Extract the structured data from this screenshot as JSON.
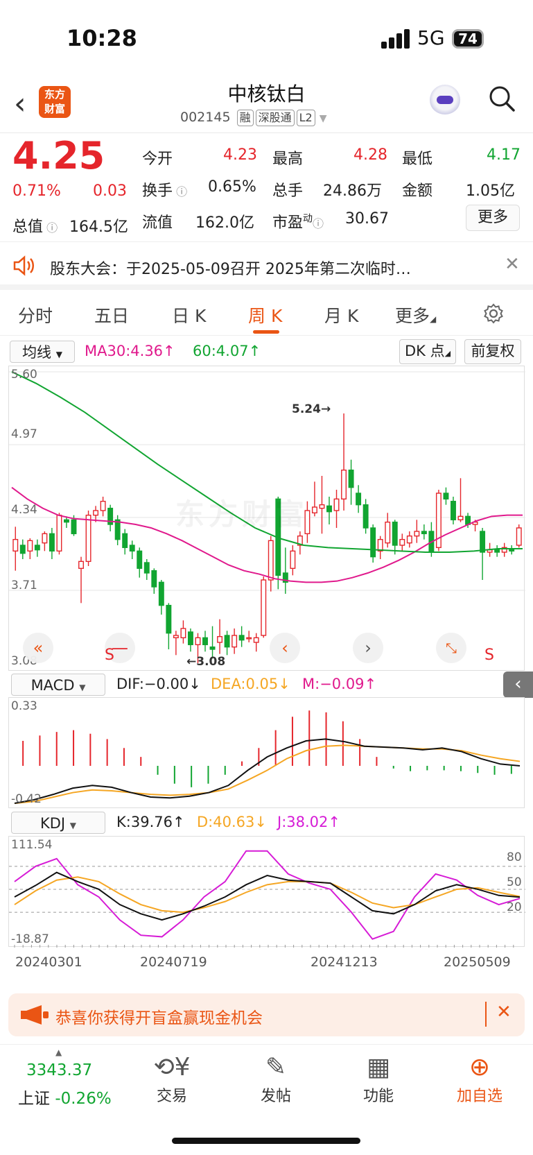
{
  "status": {
    "time": "10:28",
    "network": "5G",
    "battery": "74"
  },
  "header": {
    "back": "‹",
    "logo_line1": "东方",
    "logo_line2": "财富",
    "name": "中核钛白",
    "code": "002145",
    "tags": [
      "融",
      "深股通",
      "L2"
    ]
  },
  "quote": {
    "price": "4.25",
    "pct": "0.71%",
    "chg": "0.03",
    "open_label": "今开",
    "open": "4.23",
    "high_label": "最高",
    "high": "4.28",
    "low_label": "最低",
    "low": "4.17",
    "turnover_label": "换手",
    "turnover": "0.65%",
    "vol_label": "总手",
    "vol": "24.86万",
    "amt_label": "金额",
    "amt": "1.05亿",
    "mcap_label": "总值",
    "mcap": "164.5亿",
    "float_label": "流值",
    "float": "162.0亿",
    "pe_label": "市盈",
    "pe_sup": "动",
    "pe": "30.67",
    "more": "更多"
  },
  "notice": {
    "text": "股东大会：于2025-05-09召开 2025年第二次临时…"
  },
  "tabs": [
    "分时",
    "五日",
    "日 K",
    "周 K",
    "月 K",
    "更多"
  ],
  "ma": {
    "select": "均线",
    "ma30": "MA30:4.36",
    "ma60": "60:4.07",
    "dk": "DK 点",
    "fq": "前复权"
  },
  "kline": {
    "y_labels": [
      "5.60",
      "4.97",
      "4.34",
      "3.71",
      "3.08"
    ],
    "high_mark": "5.24",
    "low_mark": "3.08",
    "watermark": "东方财富"
  },
  "macd": {
    "select": "MACD",
    "dif": "DIF:−0.00",
    "dea": "DEA:0.05",
    "m": "M:−0.09",
    "y_top": "0.33",
    "y_bot": "-0.42"
  },
  "kdj": {
    "select": "KDJ",
    "k": "K:39.76",
    "d": "D:40.63",
    "j": "J:38.02",
    "y_top": "111.54",
    "y_bot": "-18.87",
    "lv80": "80",
    "lv50": "50",
    "lv20": "20"
  },
  "dates": [
    "20240301",
    "20240719",
    "20241213",
    "20250509"
  ],
  "colors": {
    "up": "#e5252b",
    "down": "#11a531",
    "accent": "#ea5514",
    "ma30": "#e0198c",
    "ma60": "#11a531",
    "dea": "#f5a623",
    "j": "#d61bd6"
  },
  "promo": {
    "text": "恭喜你获得开盲盒赢现金机会"
  },
  "bottom": {
    "index_value": "3343.37",
    "index_name": "上证",
    "index_pct": "-0.26%",
    "trade": "交易",
    "post": "发帖",
    "func": "功能",
    "add": "加自选"
  },
  "chart_data": {
    "type": "candlestick",
    "period": "weekly",
    "dates_shown": [
      "20240301",
      "20240719",
      "20241213",
      "20250509"
    ],
    "ylim": [
      3.08,
      5.6
    ],
    "candles": [
      [
        4.05,
        4.15,
        3.88,
        4.26
      ],
      [
        4.1,
        4.03,
        3.98,
        4.15
      ],
      [
        4.05,
        4.14,
        3.98,
        4.16
      ],
      [
        4.1,
        4.06,
        4.0,
        4.15
      ],
      [
        4.12,
        4.2,
        4.05,
        4.22
      ],
      [
        4.2,
        4.05,
        3.98,
        4.25
      ],
      [
        4.05,
        4.36,
        4.02,
        4.38
      ],
      [
        4.32,
        4.3,
        4.25,
        4.35
      ],
      [
        4.32,
        4.2,
        4.18,
        4.36
      ],
      [
        3.9,
        3.96,
        3.6,
        4.0
      ],
      [
        3.96,
        4.36,
        3.92,
        4.4
      ],
      [
        4.36,
        4.4,
        4.3,
        4.44
      ],
      [
        4.4,
        4.48,
        4.35,
        4.52
      ],
      [
        4.42,
        4.28,
        4.22,
        4.45
      ],
      [
        4.32,
        4.15,
        4.1,
        4.36
      ],
      [
        4.2,
        4.08,
        4.02,
        4.24
      ],
      [
        4.1,
        4.05,
        3.98,
        4.14
      ],
      [
        4.05,
        3.9,
        3.82,
        4.08
      ],
      [
        3.95,
        3.86,
        3.8,
        3.98
      ],
      [
        3.88,
        3.74,
        3.68,
        3.9
      ],
      [
        3.78,
        3.58,
        3.5,
        3.8
      ],
      [
        3.58,
        3.34,
        3.2,
        3.6
      ],
      [
        3.3,
        3.32,
        3.15,
        3.36
      ],
      [
        3.3,
        3.38,
        3.25,
        3.45
      ],
      [
        3.35,
        3.24,
        3.18,
        3.38
      ],
      [
        3.24,
        3.3,
        3.08,
        3.34
      ],
      [
        3.3,
        3.24,
        3.18,
        3.36
      ],
      [
        3.22,
        3.2,
        3.12,
        3.4
      ],
      [
        3.26,
        3.31,
        3.16,
        3.46
      ],
      [
        3.32,
        3.22,
        3.15,
        3.36
      ],
      [
        3.22,
        3.32,
        3.16,
        3.38
      ],
      [
        3.32,
        3.28,
        3.22,
        3.4
      ],
      [
        3.3,
        3.3,
        3.26,
        3.36
      ],
      [
        3.26,
        3.3,
        3.18,
        3.34
      ],
      [
        3.32,
        3.8,
        3.3,
        3.83
      ],
      [
        3.8,
        4.14,
        3.7,
        4.18
      ],
      [
        4.5,
        3.84,
        3.72,
        4.52
      ],
      [
        3.86,
        3.78,
        3.68,
        4.08
      ],
      [
        3.9,
        4.05,
        3.84,
        4.1
      ],
      [
        4.1,
        4.18,
        4.02,
        4.22
      ],
      [
        4.2,
        4.4,
        4.12,
        4.48
      ],
      [
        4.38,
        4.43,
        4.35,
        4.65
      ],
      [
        4.42,
        4.45,
        4.2,
        4.7
      ],
      [
        4.44,
        4.39,
        4.28,
        4.52
      ],
      [
        4.4,
        4.5,
        4.25,
        4.58
      ],
      [
        4.5,
        4.75,
        4.4,
        5.24
      ],
      [
        4.75,
        4.6,
        4.45,
        4.84
      ],
      [
        4.55,
        4.45,
        4.38,
        4.62
      ],
      [
        4.45,
        4.25,
        4.2,
        4.5
      ],
      [
        4.25,
        4.0,
        3.95,
        4.28
      ],
      [
        4.05,
        4.15,
        3.98,
        4.18
      ],
      [
        4.12,
        4.3,
        4.08,
        4.38
      ],
      [
        4.3,
        4.1,
        4.02,
        4.32
      ],
      [
        4.1,
        4.15,
        4.05,
        4.2
      ],
      [
        4.12,
        4.18,
        4.08,
        4.22
      ],
      [
        4.18,
        4.22,
        4.12,
        4.32
      ],
      [
        4.22,
        4.2,
        4.15,
        4.28
      ],
      [
        4.22,
        4.05,
        4.0,
        4.3
      ],
      [
        4.08,
        4.55,
        4.05,
        4.58
      ],
      [
        4.55,
        4.5,
        4.45,
        4.6
      ],
      [
        4.48,
        4.32,
        4.28,
        4.52
      ],
      [
        4.32,
        4.35,
        4.3,
        4.68
      ],
      [
        4.35,
        4.28,
        4.25,
        4.38
      ],
      [
        4.28,
        4.3,
        4.22,
        4.32
      ],
      [
        4.22,
        4.04,
        3.8,
        4.25
      ],
      [
        4.04,
        4.06,
        4.0,
        4.12
      ],
      [
        4.06,
        4.04,
        4.0,
        4.1
      ],
      [
        4.04,
        4.08,
        4.0,
        4.12
      ],
      [
        4.06,
        4.05,
        4.02,
        4.1
      ],
      [
        4.1,
        4.25,
        4.08,
        4.28
      ]
    ],
    "ma30": [
      4.6,
      4.5,
      4.42,
      4.36,
      4.33,
      4.32,
      4.31,
      4.3,
      4.28,
      4.25,
      4.2,
      4.14,
      4.07,
      4.0,
      3.93,
      3.88,
      3.85,
      3.81,
      3.79,
      3.78,
      3.78,
      3.79,
      3.82,
      3.86,
      3.91,
      3.97,
      4.04,
      4.12,
      4.19,
      4.25,
      4.31,
      4.35,
      4.36,
      4.36
    ],
    "ma60": [
      5.6,
      5.5,
      5.38,
      5.25,
      5.1,
      4.95,
      4.8,
      4.66,
      4.52,
      4.38,
      4.25,
      4.16,
      4.1,
      4.08,
      4.07,
      4.06,
      4.05,
      4.04,
      4.04,
      4.05,
      4.07,
      4.07
    ],
    "macd": {
      "dif": [
        -0.42,
        -0.38,
        -0.32,
        -0.25,
        -0.22,
        -0.24,
        -0.3,
        -0.35,
        -0.36,
        -0.34,
        -0.3,
        -0.22,
        -0.05,
        0.1,
        0.2,
        0.28,
        0.3,
        0.27,
        0.22,
        0.21,
        0.2,
        0.18,
        0.2,
        0.16,
        0.08,
        0.02,
        0.0
      ],
      "dea": [
        -0.42,
        -0.4,
        -0.35,
        -0.3,
        -0.27,
        -0.28,
        -0.3,
        -0.32,
        -0.33,
        -0.32,
        -0.3,
        -0.26,
        -0.16,
        -0.05,
        0.08,
        0.17,
        0.22,
        0.23,
        0.22,
        0.21,
        0.2,
        0.19,
        0.19,
        0.17,
        0.12,
        0.08,
        0.05
      ],
      "hist": [
        0.28,
        0.34,
        0.38,
        0.4,
        0.36,
        0.3,
        0.2,
        0.1,
        -0.1,
        -0.2,
        -0.24,
        -0.2,
        -0.1,
        0.05,
        0.2,
        0.4,
        0.55,
        0.62,
        0.6,
        0.5,
        0.3,
        0.1,
        -0.03,
        -0.06,
        -0.05,
        -0.05,
        -0.06,
        -0.08,
        -0.1,
        -0.09
      ]
    },
    "kdj": {
      "k": [
        40,
        55,
        72,
        60,
        50,
        30,
        18,
        10,
        18,
        28,
        40,
        56,
        68,
        62,
        60,
        58,
        40,
        22,
        18,
        30,
        48,
        56,
        50,
        42,
        39.76
      ],
      "d": [
        30,
        48,
        62,
        66,
        60,
        44,
        30,
        22,
        20,
        26,
        34,
        46,
        56,
        60,
        60,
        58,
        46,
        32,
        26,
        30,
        40,
        50,
        52,
        46,
        40.63
      ],
      "j": [
        60,
        80,
        90,
        56,
        40,
        10,
        -10,
        -12,
        10,
        40,
        60,
        100,
        100,
        70,
        58,
        50,
        20,
        -15,
        -5,
        40,
        70,
        62,
        42,
        30,
        38.02
      ]
    }
  }
}
